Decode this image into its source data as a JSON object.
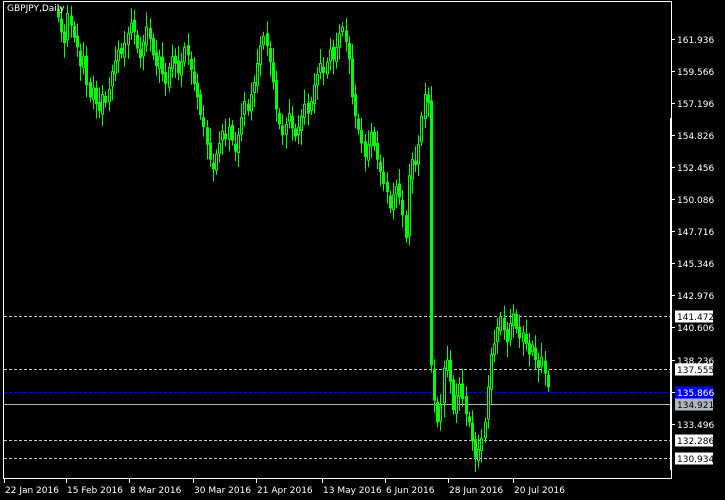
{
  "chart_data": {
    "type": "candlestick",
    "title": "GBPJPY,Daily",
    "symbol": "GBPJPY",
    "timeframe": "Daily",
    "background_color": "#000000",
    "candle_color": "#00ff00",
    "y_axis": {
      "range": [
        129.6,
        164.6
      ],
      "ticks": [
        "161.936",
        "159.566",
        "157.196",
        "154.826",
        "152.456",
        "150.086",
        "147.716",
        "145.346",
        "142.976",
        "140.606",
        "138.236",
        "135.866",
        "133.496"
      ]
    },
    "x_axis": {
      "ticks": [
        "22 Jan 2016",
        "15 Feb 2016",
        "8 Mar 2016",
        "30 Mar 2016",
        "21 Apr 2016",
        "13 May 2016",
        "6 Jun 2016",
        "28 Jun 2016",
        "20 Jul 2016"
      ]
    },
    "level_lines": [
      {
        "label": "141.472",
        "value": 141.472,
        "style": "dashed",
        "line_color": "#c8c8c8",
        "label_bg": "#ffffff",
        "label_fg": "#000000"
      },
      {
        "label": "137.555",
        "value": 137.555,
        "style": "dashed",
        "line_color": "#c8c8c8",
        "label_bg": "#ffffff",
        "label_fg": "#000000"
      },
      {
        "label": "135.866",
        "value": 135.866,
        "style": "dashed",
        "line_color": "#0000ff",
        "label_bg": "#0000ff",
        "label_fg": "#ffffff"
      },
      {
        "label": "134.921",
        "value": 134.921,
        "style": "solid",
        "line_color": "#aeb6bf",
        "label_bg": "#aeb6bf",
        "label_fg": "#000000"
      },
      {
        "label": "132.286",
        "value": 132.286,
        "style": "dashed",
        "line_color": "#c8c8c8",
        "label_bg": "#ffffff",
        "label_fg": "#000000"
      },
      {
        "label": "130.934",
        "value": 130.934,
        "style": "dashed",
        "line_color": "#c8c8c8",
        "label_bg": "#ffffff",
        "label_fg": "#000000"
      }
    ],
    "closes": [
      163.5,
      162.4,
      161.6,
      163.8,
      162.9,
      162.0,
      161.3,
      159.9,
      160.6,
      158.5,
      157.6,
      158.3,
      157.1,
      156.6,
      157.8,
      157.2,
      158.2,
      159.5,
      160.3,
      161.1,
      160.8,
      161.6,
      162.3,
      163.1,
      162.4,
      161.2,
      160.5,
      161.7,
      162.8,
      161.9,
      160.7,
      159.9,
      160.6,
      159.3,
      158.6,
      159.8,
      160.6,
      160.1,
      159.4,
      160.2,
      161.3,
      160.7,
      159.6,
      158.6,
      157.6,
      156.3,
      155.4,
      154.1,
      153.0,
      152.3,
      153.4,
      154.2,
      155.1,
      154.5,
      155.4,
      154.4,
      153.6,
      154.8,
      156.1,
      157.3,
      156.6,
      157.8,
      158.7,
      160.1,
      161.4,
      162.1,
      161.4,
      160.2,
      158.7,
      156.7,
      155.6,
      154.8,
      155.6,
      156.4,
      155.3,
      154.7,
      155.4,
      156.2,
      157.1,
      156.4,
      157.3,
      158.5,
      159.3,
      160.1,
      159.4,
      160.2,
      161.1,
      160.4,
      161.3,
      162.3,
      162.8,
      161.7,
      160.4,
      157.6,
      156.2,
      155.2,
      154.2,
      153.2,
      154.1,
      155.0,
      154.0,
      153.0,
      152.1,
      151.2,
      150.6,
      149.4,
      150.4,
      151.0,
      150.2,
      148.9,
      147.2,
      151.8,
      153.0,
      152.6,
      154.1,
      156.2,
      157.8,
      157.2,
      137.8,
      135.2,
      133.6,
      134.8,
      137.6,
      138.2,
      136.6,
      134.5,
      135.6,
      136.4,
      135.3,
      134.2,
      133.6,
      132.2,
      131.0,
      131.6,
      132.4,
      133.6,
      136.2,
      138.6,
      139.4,
      140.6,
      141.4,
      140.4,
      139.5,
      140.9,
      141.6,
      140.5,
      139.8,
      140.2,
      139.4,
      138.6,
      139.3,
      138.2,
      137.6,
      138.4,
      137.2,
      136.2
    ]
  }
}
